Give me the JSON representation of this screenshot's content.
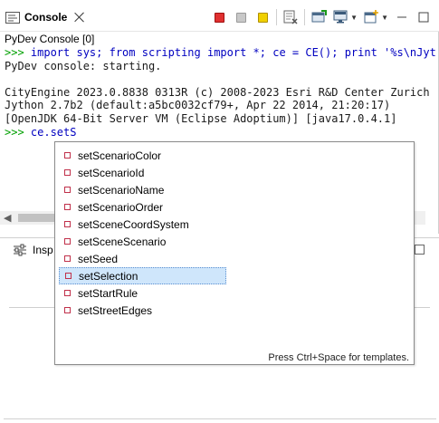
{
  "console_view": {
    "tab_label": "Console",
    "subtitle": "PyDev Console [0]",
    "lines": [
      {
        "kind": "cmd",
        "prompt": ">>> ",
        "text": "import sys; from scripting import *; ce = CE(); print '%s\\nJyth"
      },
      {
        "kind": "out",
        "text": "PyDev console: starting."
      },
      {
        "kind": "out",
        "text": ""
      },
      {
        "kind": "out",
        "text": "CityEngine 2023.0.8838 0313R (c) 2008-2023 Esri R&D Center Zurich"
      },
      {
        "kind": "out",
        "text": "Jython 2.7b2 (default:a5bc0032cf79+, Apr 22 2014, 21:20:17)"
      },
      {
        "kind": "out",
        "text": "[OpenJDK 64-Bit Server VM (Eclipse Adoptium)] [java17.0.4.1]"
      },
      {
        "kind": "cmd",
        "prompt": ">>> ",
        "text": "ce.setS"
      }
    ]
  },
  "inspector_view": {
    "tab_label": "Insp"
  },
  "completion": {
    "items": [
      {
        "label": "setScenarioColor"
      },
      {
        "label": "setScenarioId"
      },
      {
        "label": "setScenarioName"
      },
      {
        "label": "setScenarioOrder"
      },
      {
        "label": "setSceneCoordSystem"
      },
      {
        "label": "setSceneScenario"
      },
      {
        "label": "setSeed"
      },
      {
        "label": "setSelection",
        "selected": true
      },
      {
        "label": "setStartRule"
      },
      {
        "label": "setStreetEdges"
      }
    ],
    "hint": "Press Ctrl+Space for templates."
  },
  "colors": {
    "terminate": "#e03030",
    "remove_all": "#c8c8c8",
    "scroll_lock": "#f0d000",
    "prompt": "#00a000",
    "command": "#0000c0"
  }
}
